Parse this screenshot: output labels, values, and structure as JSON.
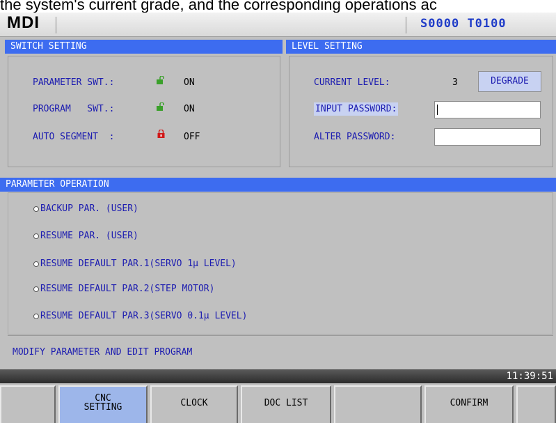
{
  "caption_text": "the system's current grade, and the corresponding operations ac",
  "header": {
    "mode": "MDI",
    "spindle": "S0000",
    "tool": "T0100"
  },
  "switch_setting": {
    "title": "SWITCH SETTING",
    "rows": [
      {
        "label": "PARAMETER SWT.:",
        "icon": "unlocked-icon",
        "value": "ON"
      },
      {
        "label": "PROGRAM   SWT.:",
        "icon": "unlocked-icon",
        "value": "ON"
      },
      {
        "label": "AUTO SEGMENT  :",
        "icon": "locked-icon",
        "value": "OFF"
      }
    ]
  },
  "level_setting": {
    "title": "LEVEL SETTING",
    "current_level_label": "CURRENT LEVEL:",
    "current_level_value": "3",
    "degrade_label": "DEGRADE",
    "input_password_label": "INPUT PASSWORD:",
    "input_password_value": "",
    "alter_password_label": "ALTER PASSWORD:",
    "alter_password_value": ""
  },
  "parameter_operation": {
    "title": "PARAMETER OPERATION",
    "options": [
      "BACKUP PAR. (USER)",
      "RESUME PAR. (USER)",
      "RESUME DEFAULT PAR.1(SERVO 1μ LEVEL)",
      "RESUME DEFAULT PAR.2(STEP MOTOR)",
      "RESUME DEFAULT PAR.3(SERVO 0.1μ LEVEL)"
    ]
  },
  "status_message": "MODIFY PARAMETER AND EDIT PROGRAM",
  "clock": "11:39:51",
  "softkeys": {
    "k1": "",
    "k2_line1": "CNC",
    "k2_line2": "SETTING",
    "k3": "CLOCK",
    "k4": "DOC LIST",
    "k5": "",
    "k6": "CONFIRM",
    "k7": ""
  },
  "colors": {
    "panel_header": "#3d6cf0",
    "label_text": "#1c1cb0",
    "spindle_tool": "#1f3cc8",
    "active_softkey": "#9db6ea",
    "lock_red": "#d01818",
    "unlock_green": "#3aa02a"
  }
}
